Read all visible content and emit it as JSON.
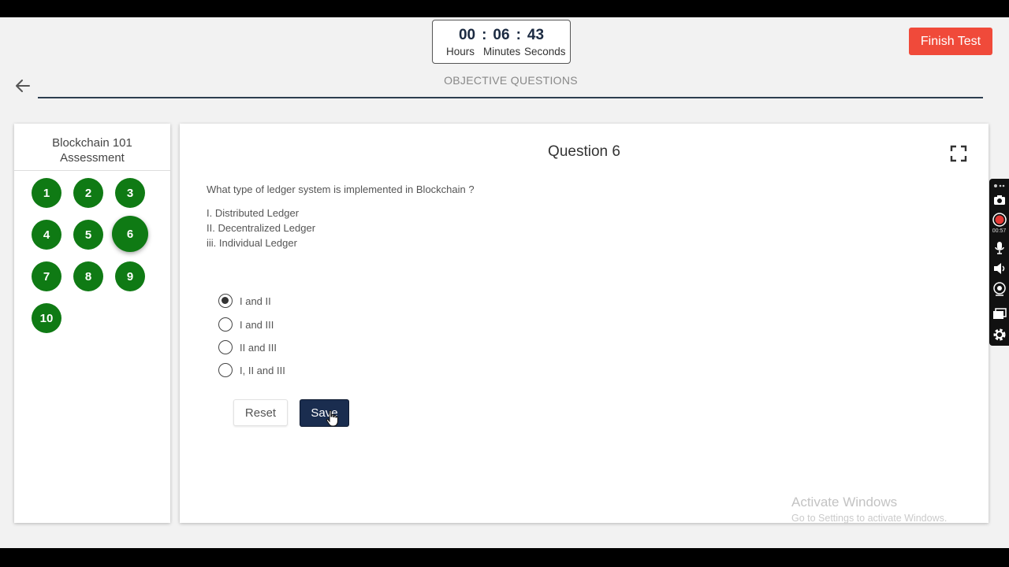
{
  "timer": {
    "hours": "00",
    "minutes": "06",
    "seconds": "43",
    "separator": ":",
    "hours_label": "Hours",
    "minutes_label": "Minutes",
    "seconds_label": "Seconds"
  },
  "header": {
    "finish_label": "Finish Test",
    "section_title": "OBJECTIVE QUESTIONS"
  },
  "nav": {
    "title_line1": "Blockchain 101",
    "title_line2": "Assessment",
    "questions": [
      "1",
      "2",
      "3",
      "4",
      "5",
      "6",
      "7",
      "8",
      "9",
      "10"
    ],
    "active_question": "6"
  },
  "question": {
    "title": "Question 6",
    "text": "What type of ledger system is implemented in Blockchain ?",
    "statements": [
      "I. Distributed Ledger",
      "II. Decentralized Ledger",
      "iii. Individual Ledger"
    ],
    "options": [
      "I and II",
      "I and III",
      "II and III",
      "I, II and III"
    ],
    "selected_option": "I and II",
    "reset_label": "Reset",
    "save_label": "Save"
  },
  "watermark": {
    "line1": "Activate Windows",
    "line2": "Go to Settings to activate Windows."
  },
  "recorder": {
    "elapsed": "00:57"
  },
  "colors": {
    "question_green": "#0f7a14",
    "finish_red": "#f04a3a",
    "save_navy": "#1a2d4f"
  }
}
